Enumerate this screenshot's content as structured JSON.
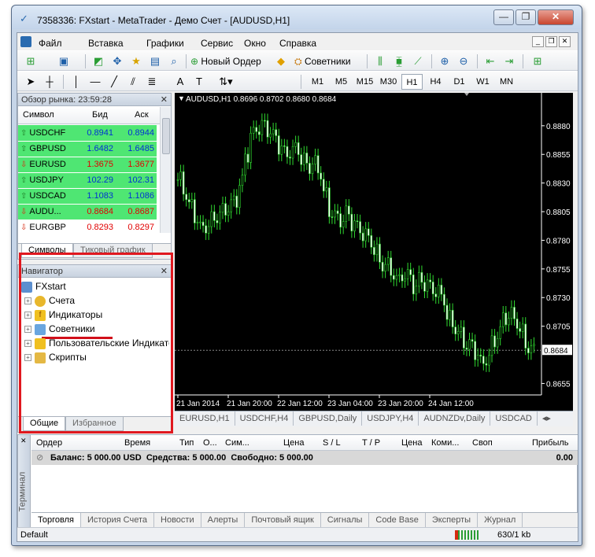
{
  "window": {
    "title": "7358336: FXstart - MetaTrader - Демо Счет - [AUDUSD,H1]",
    "min": "—",
    "max": "❐",
    "close": "✕"
  },
  "menu": [
    "Файл",
    "Вставка",
    "Графики",
    "Сервис",
    "Окно",
    "Справка"
  ],
  "toolbar": {
    "new_order": "Новый Ордер",
    "experts": "Советники",
    "text_tool": "A"
  },
  "timeframes": [
    "M1",
    "M5",
    "M15",
    "M30",
    "H1",
    "H4",
    "D1",
    "W1",
    "MN"
  ],
  "market_watch": {
    "title": "Обзор рынка: 23:59:28",
    "cols": [
      "Символ",
      "Бид",
      "Аск"
    ],
    "rows": [
      {
        "symbol": "USDCHF",
        "bid": "0.8941",
        "ask": "0.8944",
        "dir": "up"
      },
      {
        "symbol": "GBPUSD",
        "bid": "1.6482",
        "ask": "1.6485",
        "dir": "up"
      },
      {
        "symbol": "EURUSD",
        "bid": "1.3675",
        "ask": "1.3677",
        "dir": "down"
      },
      {
        "symbol": "USDJPY",
        "bid": "102.29",
        "ask": "102.31",
        "dir": "up"
      },
      {
        "symbol": "USDCAD",
        "bid": "1.1083",
        "ask": "1.1086",
        "dir": "up"
      },
      {
        "symbol": "AUDU...",
        "bid": "0.8684",
        "ask": "0.8687",
        "dir": "down"
      },
      {
        "symbol": "EURGBP",
        "bid": "0.8293",
        "ask": "0.8297",
        "dir": "down"
      }
    ],
    "tabs": [
      "Символы",
      "Тиковый график"
    ]
  },
  "navigator": {
    "title": "Навигатор",
    "root": "FXstart",
    "items": [
      "Счета",
      "Индикаторы",
      "Советники",
      "Пользовательские Индикаторы",
      "Скрипты"
    ],
    "tabs": [
      "Общие",
      "Избранное"
    ]
  },
  "chart": {
    "header": "AUDUSD,H1  0.8696 0.8702 0.8680 0.8684",
    "prices": [
      "0.8880",
      "0.8855",
      "0.8830",
      "0.8805",
      "0.8780",
      "0.8755",
      "0.8730",
      "0.8705",
      "0.8655"
    ],
    "current": "0.8684",
    "dates": [
      "21 Jan 2014",
      "21 Jan 20:00",
      "22 Jan 12:00",
      "23 Jan 04:00",
      "23 Jan 20:00",
      "24 Jan 12:00"
    ],
    "tabs": [
      "EURUSD,H1",
      "USDCHF,H4",
      "GBPUSD,Daily",
      "USDJPY,H4",
      "AUDNZDv,Daily",
      "USDCAD"
    ]
  },
  "terminal": {
    "side_label": "Терминал",
    "cols": [
      "Ордер",
      "Время",
      "Тип",
      "О...",
      "Сим...",
      "Цена",
      "S / L",
      "T / P",
      "Цена",
      "Коми...",
      "Своп",
      "Прибыль"
    ],
    "balance": "Баланс: 5 000.00 USD  Средства: 5 000.00  Свободно: 5 000.00",
    "profit": "0.00",
    "tabs": [
      "Торговля",
      "История Счета",
      "Новости",
      "Алерты",
      "Почтовый ящик",
      "Сигналы",
      "Code Base",
      "Эксперты",
      "Журнал"
    ]
  },
  "status": {
    "profile": "Default",
    "traffic": "630/1 kb"
  },
  "colors": {
    "highlight": "#e0181f",
    "candle": "#2fd82f",
    "chart_bg": "#000000"
  }
}
